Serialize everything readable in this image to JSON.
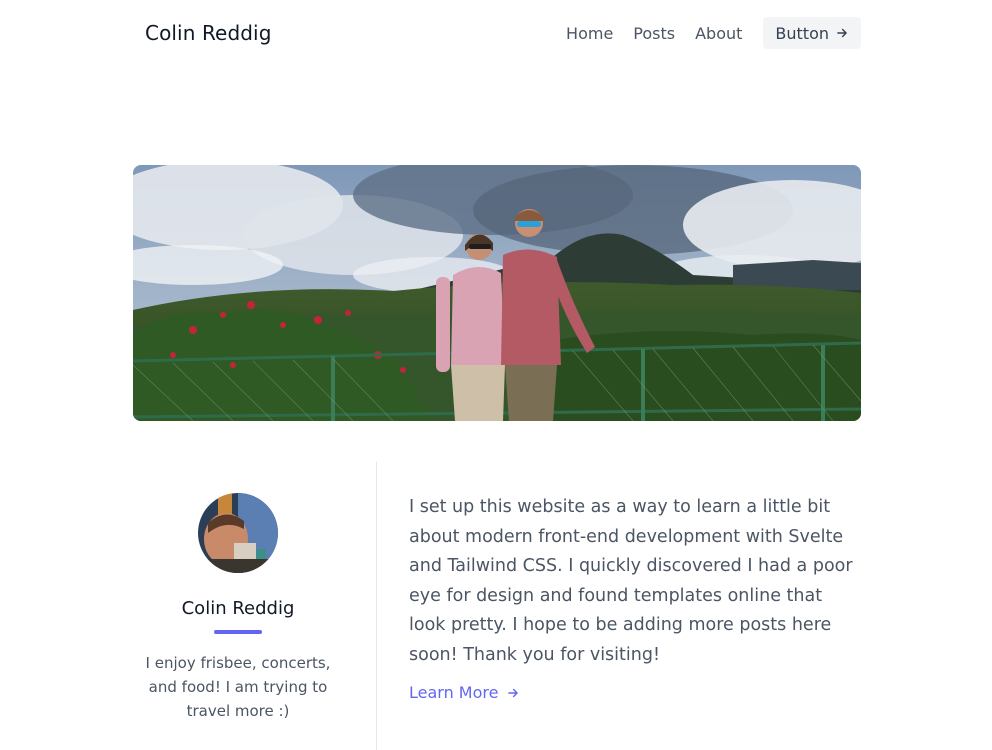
{
  "header": {
    "brand": "Colin Reddig",
    "nav": [
      {
        "label": "Home"
      },
      {
        "label": "Posts"
      },
      {
        "label": "About"
      }
    ],
    "button_label": "Button",
    "button_icon": "arrow-right-icon"
  },
  "hero": {
    "alt": "Two people standing in front of a volcano and green landscape"
  },
  "profile": {
    "name": "Colin Reddig",
    "bio": "I enjoy frisbee, concerts, and food! I am trying to travel more :)",
    "accent_color": "#6366f1"
  },
  "content": {
    "text": "I set up this website as a way to learn a little bit about modern front-end development with Svelte and Tailwind CSS. I quickly discovered I had a poor eye for design and found templates online that look pretty. I hope to be adding more posts here soon! Thank you for visiting!",
    "link_label": "Learn More",
    "link_icon": "arrow-right-icon"
  }
}
